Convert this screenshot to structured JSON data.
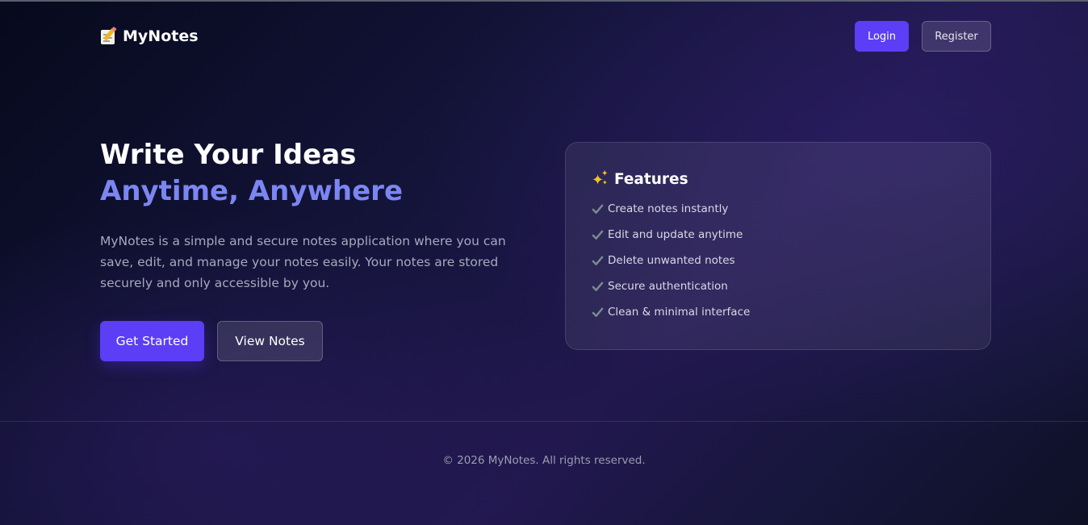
{
  "header": {
    "brand": "MyNotes",
    "brand_icon": "memo-pencil-icon",
    "login_label": "Login",
    "register_label": "Register"
  },
  "hero": {
    "title": "Write Your Ideas",
    "subtitle": "Anytime, Anywhere",
    "description": "MyNotes is a simple and secure notes application where you can save, edit, and manage your notes easily. Your notes are stored securely and only accessible by you.",
    "primary_cta": "Get Started",
    "secondary_cta": "View Notes"
  },
  "features": {
    "title": "Features",
    "title_icon": "sparkles-icon",
    "item_icon": "check-mark-icon",
    "items": [
      "Create notes instantly",
      "Edit and update anytime",
      "Delete unwanted notes",
      "Secure authentication",
      "Clean & minimal interface"
    ]
  },
  "footer": {
    "copyright": "© 2026 MyNotes. All rights reserved."
  },
  "colors": {
    "accent": "#5b3ef5",
    "subtitle": "#7b86f3",
    "background_dark": "#0b0f24",
    "background_purple": "#21184e"
  }
}
